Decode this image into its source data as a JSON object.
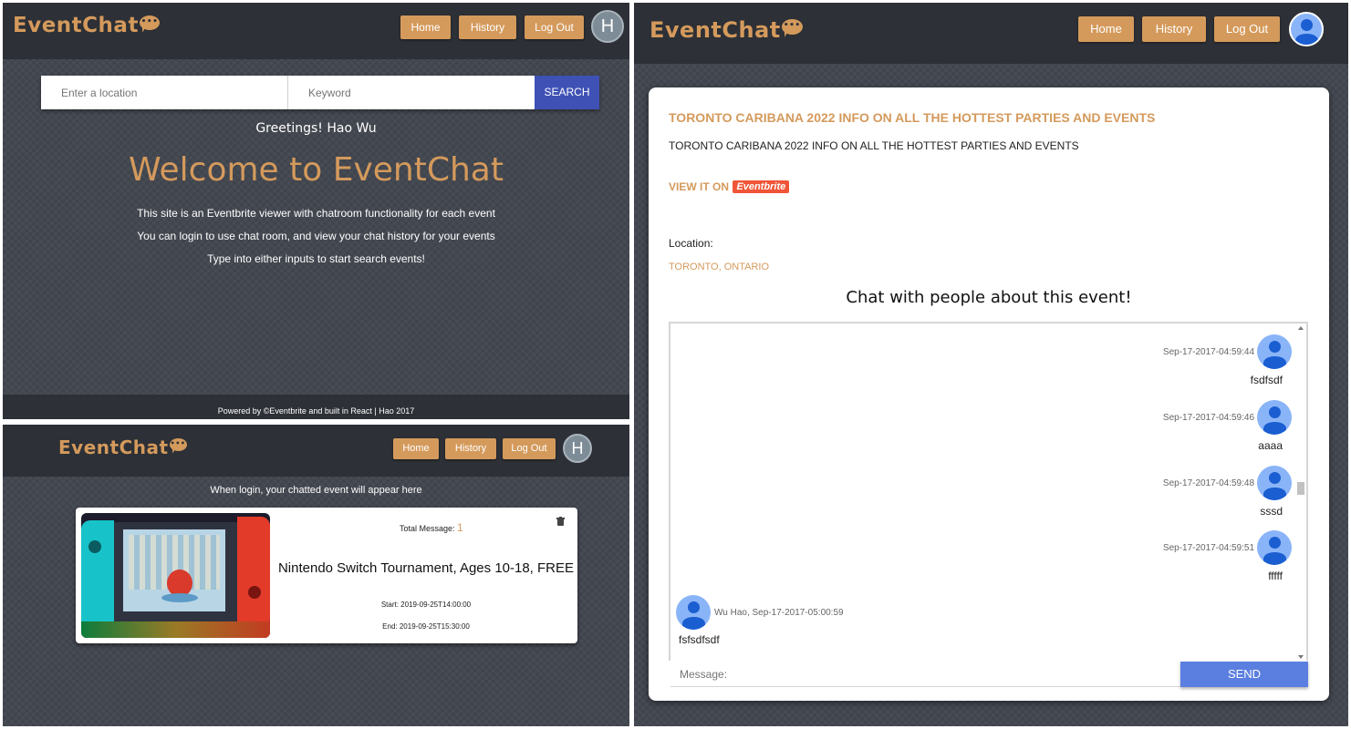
{
  "nav": {
    "logo": "EventChat",
    "home": "Home",
    "history": "History",
    "logout": "Log Out",
    "avatar_initial": "H"
  },
  "home": {
    "location_placeholder": "Enter a location",
    "keyword_placeholder": "Keyword",
    "search_label": "SEARCH",
    "greeting": "Greetings! Hao Wu",
    "welcome": "Welcome to EventChat",
    "desc1": "This site is an Eventbrite viewer with chatroom functionality for each event",
    "desc2": "You can login to use chat room, and view your chat history for your events",
    "desc3": "Type into either inputs to start search events!",
    "footer": "Powered by ©Eventbrite and built in React | Hao 2017"
  },
  "history": {
    "note": "When login, your chatted event will appear here",
    "card": {
      "total_label": "Total Message:",
      "total_value": "1",
      "title": "Nintendo Switch Tournament, Ages 10-18, FREE",
      "start": "Start: 2019-09-25T14:00:00",
      "end": "End: 2019-09-25T15:30:00"
    }
  },
  "event": {
    "title": "TORONTO CARIBANA 2022 INFO ON ALL THE HOTTEST PARTIES AND EVENTS",
    "subtitle": "TORONTO CARIBANA 2022 INFO ON ALL THE HOTTEST PARTIES AND EVENTS",
    "view_it_on": "VIEW IT ON",
    "eventbrite_badge": "Eventbrite",
    "location_label": "Location:",
    "location_value": "TORONTO, ONTARIO",
    "chat_heading": "Chat with people about this event!",
    "messages": [
      {
        "time": "Sep-17-2017-04:59:44",
        "text": "fsdfsdf"
      },
      {
        "time": "Sep-17-2017-04:59:46",
        "text": "aaaa"
      },
      {
        "time": "Sep-17-2017-04:59:48",
        "text": "sssd"
      },
      {
        "time": "Sep-17-2017-04:59:51",
        "text": "fffff"
      }
    ],
    "other_message": {
      "author": "Wu Hao",
      "time": ", Sep-17-2017-05:00:59",
      "text": "fsfsdfsdf"
    },
    "message_placeholder": "Message:",
    "send_label": "SEND"
  },
  "colors": {
    "accent": "#d49a5c",
    "navbar": "#2d3036",
    "background": "#40444d",
    "send": "#5b7fe0",
    "search": "#3f51b5"
  }
}
